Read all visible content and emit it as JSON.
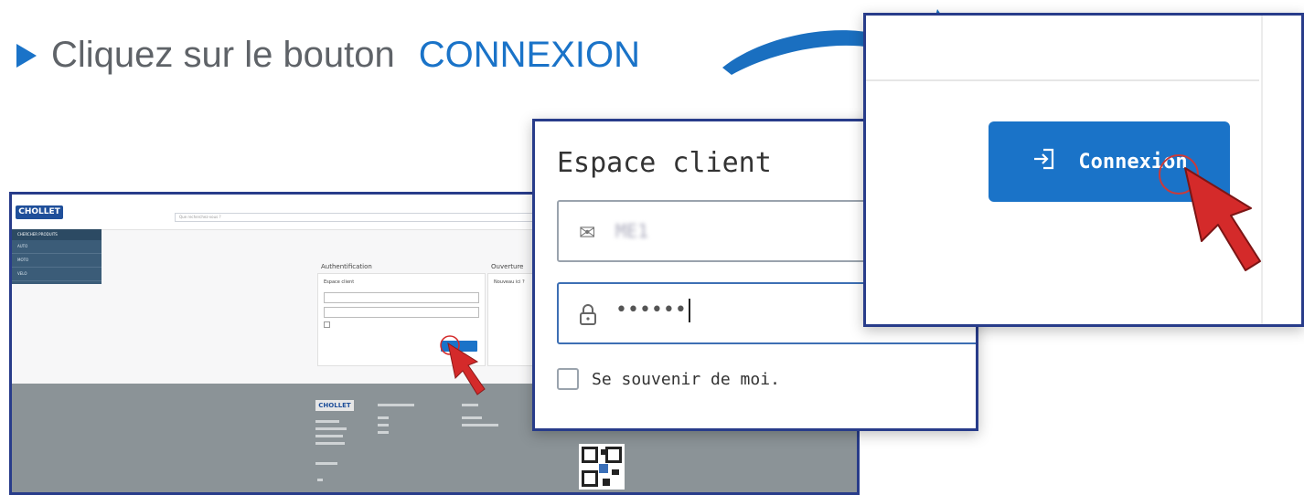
{
  "instruction": {
    "text": "Cliquez sur le bouton",
    "highlight": "CONNEXION"
  },
  "background_site": {
    "logo": "CHOLLET",
    "search_placeholder": "Que recherchez-vous ?",
    "sidebar_header": "CHERCHER PRODUITS",
    "sidebar_items": [
      "AUTO",
      "MOTO",
      "VELO"
    ],
    "auth_title": "Authentification",
    "auth_label": "Espace client",
    "open_title": "Ouverture",
    "open_question": "Nouveau ici ?",
    "footer_logo": "CHOLLET"
  },
  "login": {
    "title": "Espace client",
    "email_icon": "envelope-icon",
    "email_value": "ME1",
    "password_icon": "lock-icon",
    "password_value": "••••••",
    "remember_label": "Se souvenir de moi."
  },
  "connexion": {
    "button_icon": "login-arrow-icon",
    "button_label": "Connexion"
  },
  "colors": {
    "accent": "#1a73c8",
    "frame": "#283c8a",
    "cursor": "#d42a2a"
  }
}
